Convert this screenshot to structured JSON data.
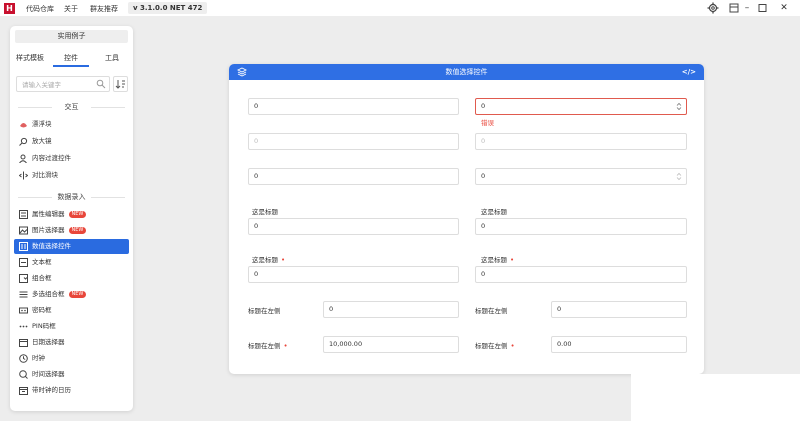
{
  "titlebar": {
    "logo": "H",
    "menu": [
      "代码仓库",
      "关于",
      "群友推荐"
    ],
    "version": "v 3.1.0.0 NET 472",
    "icons": [
      "gear-icon",
      "palette-icon",
      "minimize-icon",
      "maximize-icon",
      "close-icon"
    ]
  },
  "sidebar": {
    "title": "实用例子",
    "tabs": [
      "样式模板",
      "控件",
      "工具"
    ],
    "active_tab": "控件",
    "search_placeholder": "请输入关键字",
    "groups": [
      {
        "label": "交互",
        "items": [
          {
            "label": "漂浮块",
            "icon": "lotus-icon"
          },
          {
            "label": "放大镜",
            "icon": "magnifier-icon"
          },
          {
            "label": "内容过渡控件",
            "icon": "user-transition-icon"
          },
          {
            "label": "对比滑块",
            "icon": "compare-slider-icon"
          }
        ]
      },
      {
        "label": "数据录入",
        "items": [
          {
            "label": "属性编辑器",
            "icon": "property-icon",
            "badge": "NEW"
          },
          {
            "label": "图片选择器",
            "icon": "image-icon",
            "badge": "NEW"
          },
          {
            "label": "数值选择控件",
            "icon": "numeric-icon",
            "active": true
          },
          {
            "label": "文本框",
            "icon": "textbox-icon"
          },
          {
            "label": "组合框",
            "icon": "combobox-icon"
          },
          {
            "label": "多选组合框",
            "icon": "multi-combobox-icon",
            "badge": "NEW"
          },
          {
            "label": "密码框",
            "icon": "password-icon"
          },
          {
            "label": "PIN码框",
            "icon": "pin-icon"
          },
          {
            "label": "日期选择器",
            "icon": "calendar-icon"
          },
          {
            "label": "时钟",
            "icon": "clock-icon"
          },
          {
            "label": "时间选择器",
            "icon": "time-picker-icon"
          },
          {
            "label": "带时钟的日历",
            "icon": "calendar-clock-icon"
          }
        ]
      }
    ]
  },
  "panel": {
    "title": "数值选择控件",
    "code_icon": "</>",
    "left": {
      "r1": "0",
      "r2": "0",
      "r3": "0",
      "r4_label": "这是标题",
      "r4": "0",
      "r5_label": "这是标题",
      "r5": "0",
      "r6_label": "标题在左侧",
      "r6": "0",
      "r7_label": "标题在左侧",
      "r7": "10,000.00"
    },
    "right": {
      "r1": "0",
      "r1_error": "错误",
      "r2": "0",
      "r3": "0",
      "r4_label": "这是标题",
      "r4": "0",
      "r5_label": "这是标题",
      "r5": "0",
      "r6_label": "标题在左侧",
      "r6": "0",
      "r7_label": "标题在左侧",
      "r7": "0.00"
    },
    "required_mark": "•"
  },
  "colors": {
    "accent": "#2f6fe4",
    "error": "#e8463a",
    "badge": "#e8463a"
  }
}
